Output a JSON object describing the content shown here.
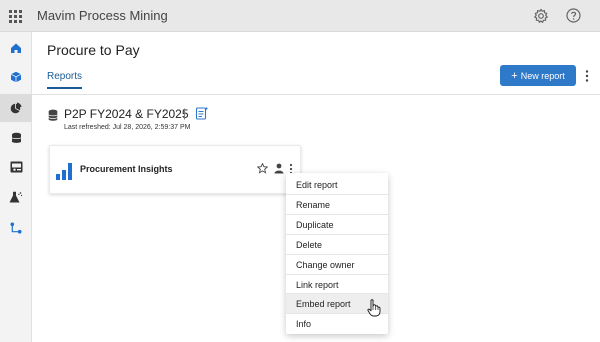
{
  "app": {
    "title": "Mavim Process Mining"
  },
  "page": {
    "title": "Procure to Pay",
    "tab_reports": "Reports",
    "new_report_label": "New report",
    "new_report_plus": "+"
  },
  "dataset": {
    "title": "P2P FY2024 & FY2025",
    "separator": "|",
    "last_refreshed": "Last refreshed: Jul 28, 2026, 2:59:37 PM"
  },
  "report_card": {
    "title": "Procurement Insights"
  },
  "menu": {
    "items": [
      {
        "label": "Edit report"
      },
      {
        "label": "Rename"
      },
      {
        "label": "Duplicate"
      },
      {
        "label": "Delete"
      },
      {
        "label": "Change owner"
      },
      {
        "label": "Link report"
      },
      {
        "label": "Embed report"
      },
      {
        "label": "Info"
      }
    ]
  },
  "sidebar": {
    "items": [
      {
        "icon": "home-icon"
      },
      {
        "icon": "cube-icon"
      },
      {
        "icon": "pie-chart-icon"
      },
      {
        "icon": "database-icon"
      },
      {
        "icon": "dashboard-icon"
      },
      {
        "icon": "flask-icon"
      },
      {
        "icon": "process-flow-icon"
      }
    ]
  },
  "colors": {
    "accent": "#2f79c9",
    "tab_active": "#1a5c99",
    "topbar": "#e8e8e8",
    "sidebar": "#f3f3f3"
  }
}
